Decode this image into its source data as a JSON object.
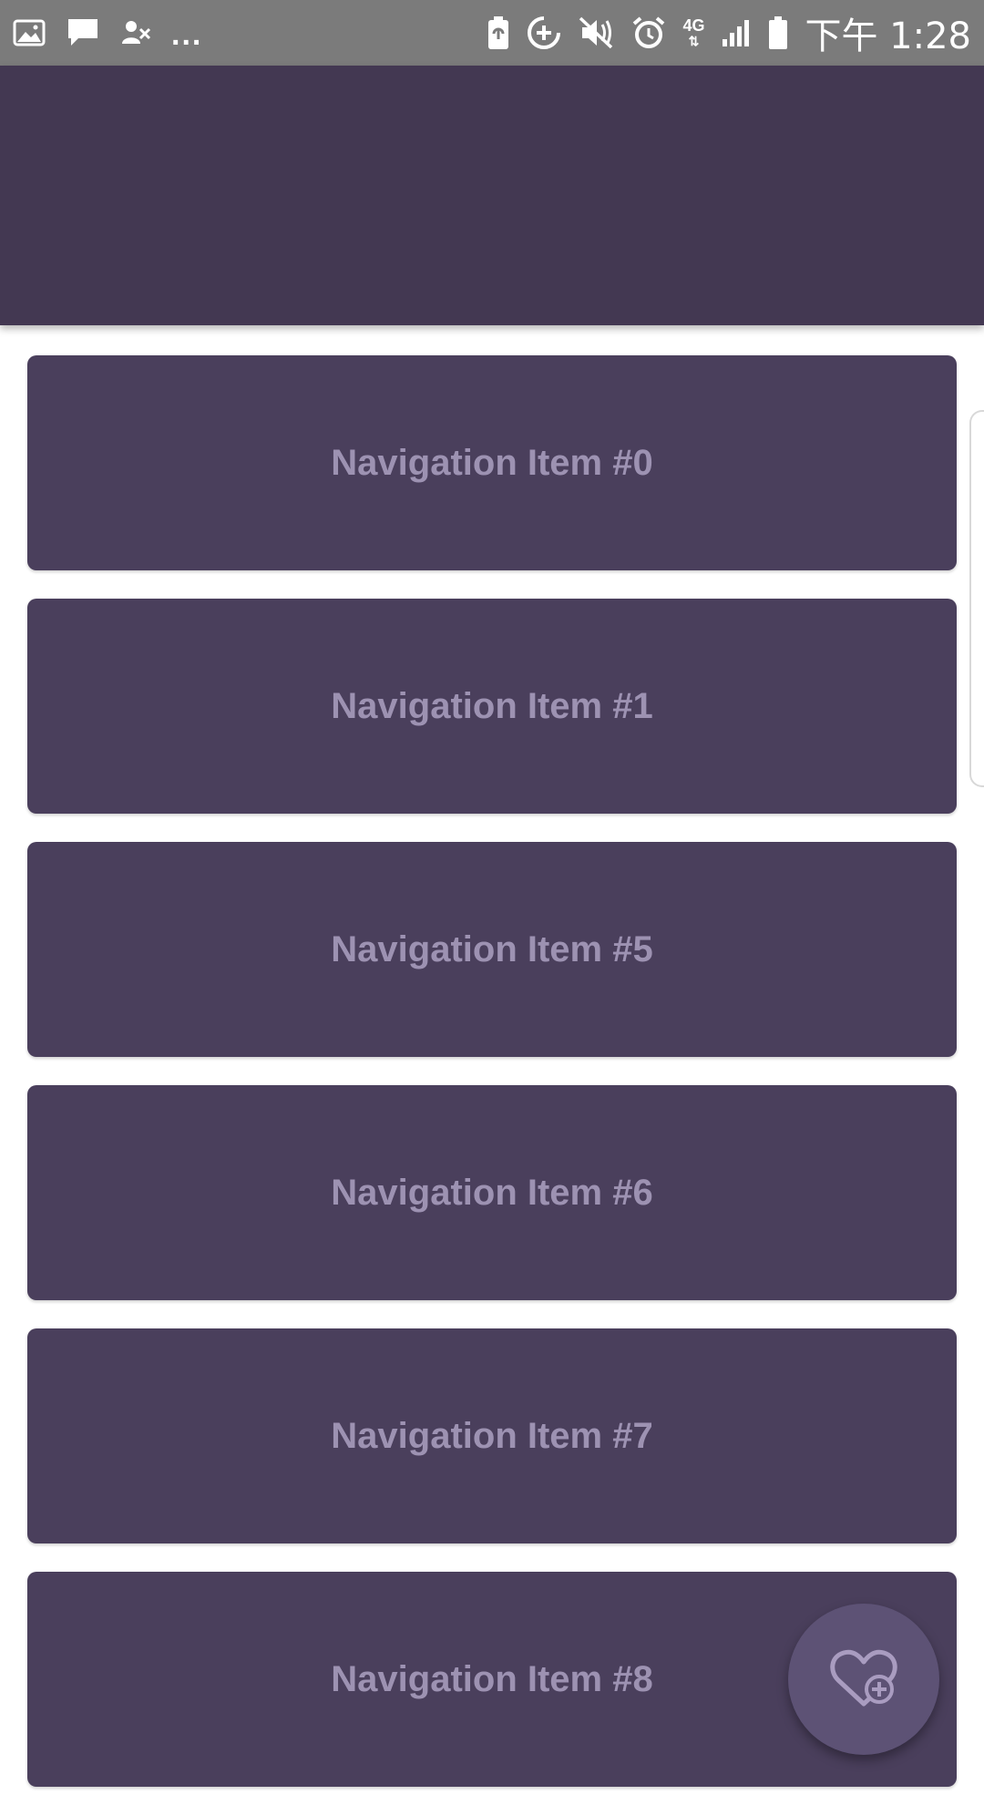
{
  "status_bar": {
    "network": "4G",
    "clock": "下午 1:28",
    "overflow": "...",
    "icons": [
      "gallery-icon",
      "message-icon",
      "contacts-icon",
      "battery-saver-icon",
      "data-saver-icon",
      "mute-icon",
      "alarm-icon",
      "signal-icon",
      "battery-icon"
    ]
  },
  "nav": {
    "items": [
      {
        "label": "Navigation Item #0"
      },
      {
        "label": "Navigation Item #1"
      },
      {
        "label": "Navigation Item #5"
      },
      {
        "label": "Navigation Item #6"
      },
      {
        "label": "Navigation Item #7"
      },
      {
        "label": "Navigation Item #8"
      }
    ]
  },
  "fab": {
    "icon": "heart-plus-icon"
  },
  "colors": {
    "app_bar": "#433852",
    "card": "#4a3f5c",
    "card_text": "#9d92b2",
    "fab": "#5d5275",
    "status_bar": "#7b7b7b"
  }
}
